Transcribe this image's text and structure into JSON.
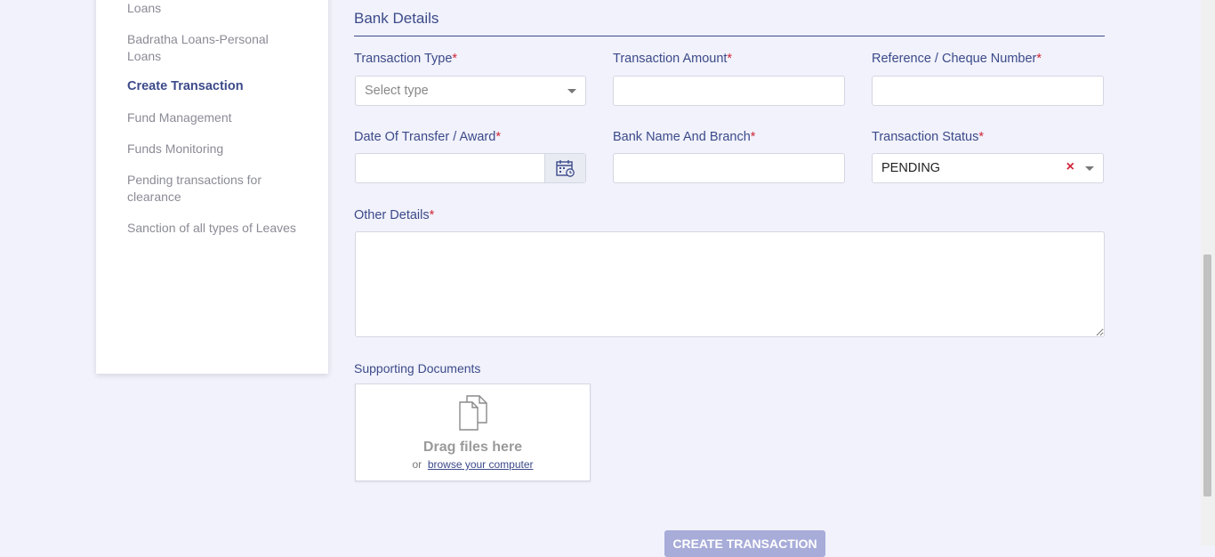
{
  "sidebar": {
    "items": [
      {
        "label": "Loans",
        "active": false
      },
      {
        "label": "Badratha Loans-Personal Loans",
        "active": false
      },
      {
        "label": "Create Transaction",
        "active": true
      },
      {
        "label": "Fund Management",
        "active": false
      },
      {
        "label": "Funds Monitoring",
        "active": false
      },
      {
        "label": "Pending transactions for clearance",
        "active": false
      },
      {
        "label": "Sanction of all types of Leaves",
        "active": false
      }
    ]
  },
  "form": {
    "section_title": "Bank Details",
    "required_mark": "*",
    "transaction_type": {
      "label": "Transaction Type",
      "placeholder": "Select type"
    },
    "transaction_amount": {
      "label": "Transaction Amount",
      "value": ""
    },
    "reference_number": {
      "label": "Reference / Cheque Number",
      "value": ""
    },
    "date_of_transfer": {
      "label": "Date Of Transfer / Award",
      "value": ""
    },
    "bank_name_branch": {
      "label": "Bank Name And Branch",
      "value": ""
    },
    "transaction_status": {
      "label": "Transaction Status",
      "value": "PENDING",
      "clear_glyph": "×"
    },
    "other_details": {
      "label": "Other Details",
      "value": ""
    },
    "supporting_documents": {
      "label": "Supporting Documents",
      "drag_text": "Drag files here",
      "or_text": "or",
      "browse_text": "browse your computer"
    },
    "submit_label": "CREATE TRANSACTION"
  },
  "colors": {
    "accent": "#3c4a8a",
    "required": "#d0263a",
    "page_bg": "#f1f2fb",
    "submit_bg": "#a8acd9"
  },
  "icons": {
    "calendar": "calendar-icon",
    "documents": "documents-icon"
  }
}
